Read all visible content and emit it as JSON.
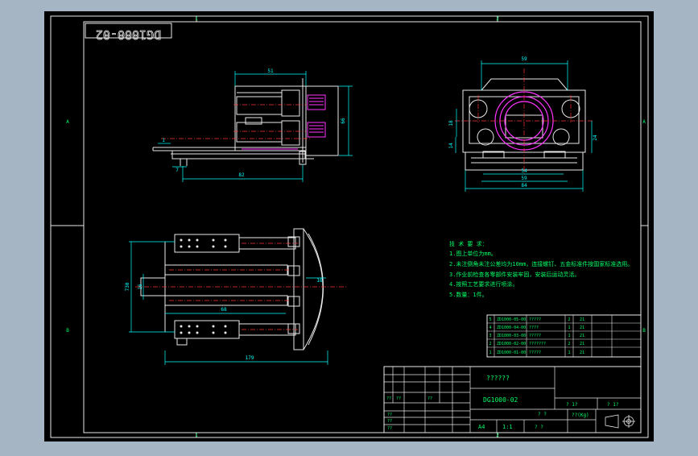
{
  "colors": {
    "background": "#a6b5c4",
    "paper": "#000000",
    "line": "#e8e8e8",
    "green": "#00ff66",
    "cyan": "#00ffff",
    "magenta": "#ff33ff",
    "red": "#ff3333",
    "yellow": "#ffff33",
    "blue": "#5555ff"
  },
  "stamp": "DG1000-02",
  "zone_labels": {
    "top_left_num": "1",
    "top_right_num": "2",
    "bottom_left_num": "1",
    "bottom_right_num": "2",
    "left_a": "A",
    "left_b": "B",
    "right_a": "A",
    "right_b": "B"
  },
  "dims": {
    "top_side_width": "51",
    "side_height": "66",
    "side_small": "1",
    "side_offset": "7",
    "side_length": "82",
    "front_width_top": "59",
    "front_h1": "18",
    "front_h2": "14",
    "front_h3": "24",
    "front_w1": "54",
    "front_w2": "59",
    "front_w3": "84",
    "plan_height_outer": "730",
    "plan_height_inner": "16",
    "plan_width_inner": "68",
    "plan_radius": "16",
    "plan_length": "179"
  },
  "notes": {
    "title": "技 术 要 求：",
    "lines": [
      "1.图上单位为mm。",
      "2.未注倒角未注公差均为10mm，连接螺钉、五金标准件按国家标准选用。",
      "3.作业前检查各零部件安装牢固，安装后运动灵活。",
      "4.按照工艺要求进行喷涂。",
      "5.数量：1件。"
    ]
  },
  "bom": [
    {
      "no": "5",
      "code": "ZD1000-05-00",
      "name": "?????",
      "qty": "2",
      "mat": "21"
    },
    {
      "no": "4",
      "code": "ZD1000-04-00",
      "name": "????",
      "qty": "1",
      "mat": "21"
    },
    {
      "no": "3",
      "code": "ZD1000-03-00",
      "name": "?????",
      "qty": "1",
      "mat": "21"
    },
    {
      "no": "2",
      "code": "ZD1000-02-00",
      "name": "???????",
      "qty": "2",
      "mat": "21"
    },
    {
      "no": "1",
      "code": "ZD1000-01-00",
      "name": "?????",
      "qty": "1",
      "mat": "21"
    }
  ],
  "title_block": {
    "project": "??????",
    "drawing_no": "DG1000-02",
    "size": "A4",
    "scale": "1:1",
    "weight_label": "??(Kg)",
    "cell_a": "? ?",
    "cell_b": "? ?",
    "sheet_a": "? 1?",
    "sheet_b": "? 1?",
    "rows": [
      "??",
      "??",
      "??",
      "??",
      "??",
      "??"
    ]
  }
}
